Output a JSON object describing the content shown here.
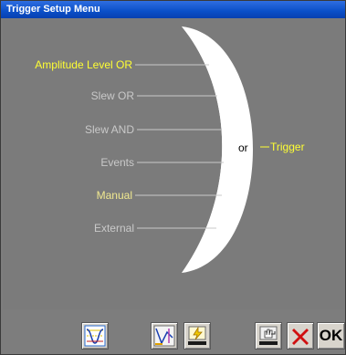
{
  "window": {
    "title": "Trigger Setup Menu"
  },
  "inputs": [
    {
      "label": "Amplitude Level OR",
      "state": "active"
    },
    {
      "label": "Slew OR",
      "state": "inactive"
    },
    {
      "label": "Slew AND",
      "state": "inactive"
    },
    {
      "label": "Events",
      "state": "inactive"
    },
    {
      "label": "Manual",
      "state": "highlighted"
    },
    {
      "label": "External",
      "state": "inactive"
    }
  ],
  "gate": {
    "label": "or",
    "output": "Trigger"
  },
  "toolbar": {
    "buttons": [
      {
        "icon": "waveform-trigger-icon"
      },
      {
        "icon": "slew-edit-icon"
      },
      {
        "icon": "event-lightning-icon"
      },
      {
        "icon": "hand-tool-icon"
      },
      {
        "icon": "cancel-x-icon"
      },
      {
        "icon": "ok-icon",
        "label": "OK"
      }
    ]
  },
  "colors": {
    "titlebar": "#0a4fc8",
    "background": "#7b7b7b",
    "active_label": "#ffff33",
    "inactive_label": "#c9c9c9",
    "highlight_label": "#f0e890",
    "gate_fill": "#ffffff",
    "cancel_red": "#d01010"
  }
}
